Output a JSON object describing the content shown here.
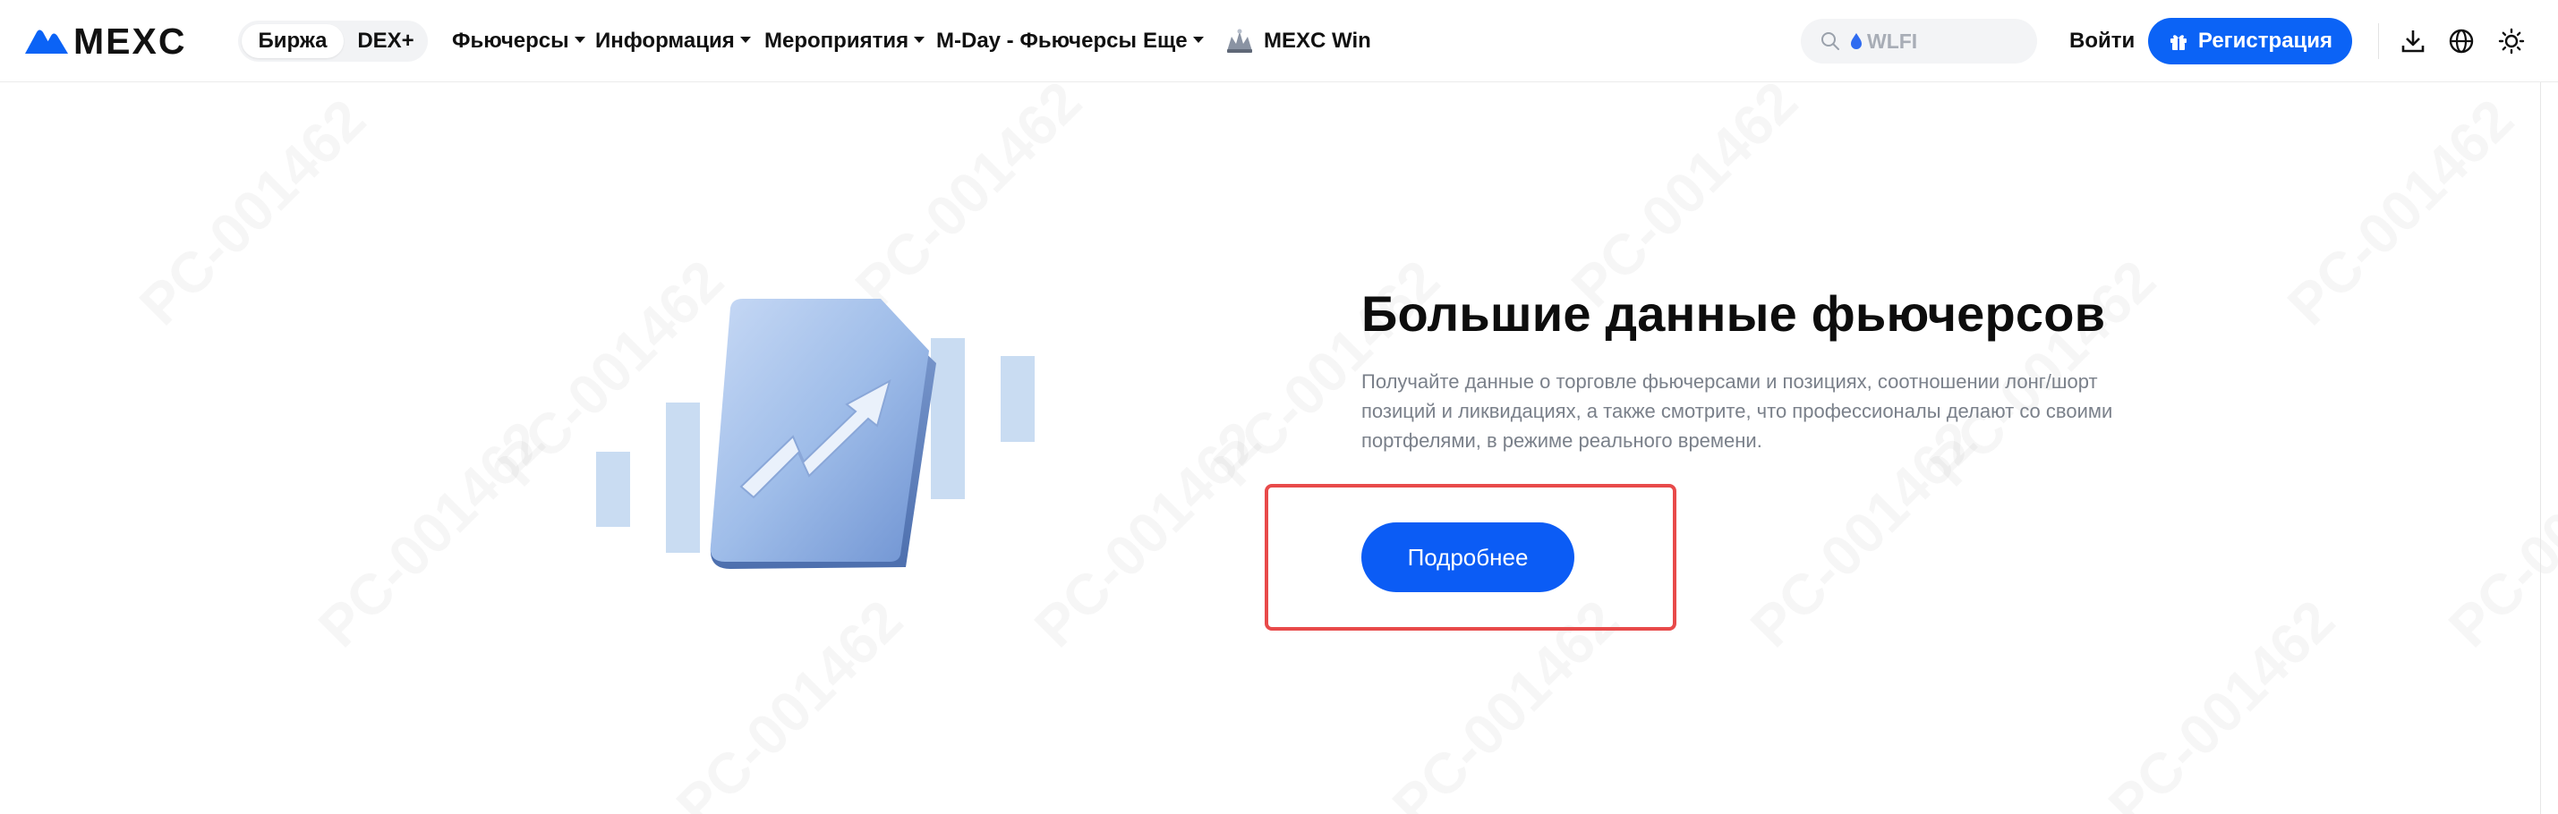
{
  "header": {
    "logo_text": "MEXC",
    "segment": {
      "active": "Биржа",
      "other": "DEX+"
    },
    "nav": [
      {
        "label": "Фьючерсы",
        "has_dropdown": true
      },
      {
        "label": "Информация",
        "has_dropdown": true
      },
      {
        "label": "Мероприятия",
        "has_dropdown": true
      },
      {
        "label": "M-Day - Фьючерсы",
        "has_dropdown": false
      },
      {
        "label": "Еще",
        "has_dropdown": true
      },
      {
        "label": "MEXC Win",
        "has_dropdown": false,
        "icon": "mexc-win-icon"
      }
    ],
    "search_placeholder": "WLFI",
    "login_label": "Войти",
    "register_label": "Регистрация",
    "icons": [
      "download-icon",
      "globe-icon",
      "theme-sun-icon"
    ]
  },
  "hero": {
    "title": "Большие данные фьючерсов",
    "description": "Получайте данные о торговле фьючерсами и позициях, соотношении лонг/шорт позиций и ликвидациях, а также смотрите, что профессионалы делают со своими портфелями, в режиме реального времени.",
    "button_label": "Подробнее"
  },
  "watermark_text": "PC-001462",
  "colors": {
    "brand_blue": "#0b63f6",
    "button_blue": "#0b5cf5",
    "highlight_red": "#e84a4a",
    "text_muted": "#7a808a",
    "bar_blue": "#c9dcf2"
  }
}
